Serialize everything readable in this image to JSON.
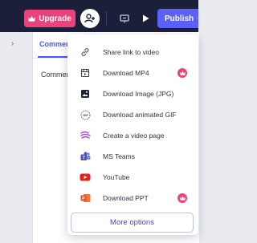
{
  "topbar": {
    "upgrade_label": "Upgrade",
    "publish_label": "Publish",
    "icons": [
      "crown-icon",
      "add-user-icon",
      "present-icon",
      "play-icon",
      "chevron-down-icon"
    ]
  },
  "panel": {
    "tab_comments": "Commen",
    "comments_label": "Commer"
  },
  "menu": {
    "items": [
      {
        "label": "Share link to video",
        "icon": "link-icon",
        "premium": false
      },
      {
        "label": "Download MP4",
        "icon": "film-icon",
        "premium": true
      },
      {
        "label": "Download Image (JPG)",
        "icon": "image-icon",
        "premium": false
      },
      {
        "label": "Download animated GIF",
        "icon": "gif-icon",
        "premium": false
      },
      {
        "label": "Create a video page",
        "icon": "brush-icon",
        "premium": false
      },
      {
        "label": "MS Teams",
        "icon": "ms-teams-icon",
        "premium": false
      },
      {
        "label": "YouTube",
        "icon": "youtube-icon",
        "premium": false
      },
      {
        "label": "Download PPT",
        "icon": "powerpoint-icon",
        "premium": true
      }
    ],
    "more_options": "More options"
  },
  "colors": {
    "topbar": "#1c1f3a",
    "upgrade": "#e8447b",
    "publish": "#5b61f6",
    "accent": "#4a58f2",
    "youtube": "#e62117",
    "teams": "#5059c9",
    "ppt": "#d9532b"
  }
}
